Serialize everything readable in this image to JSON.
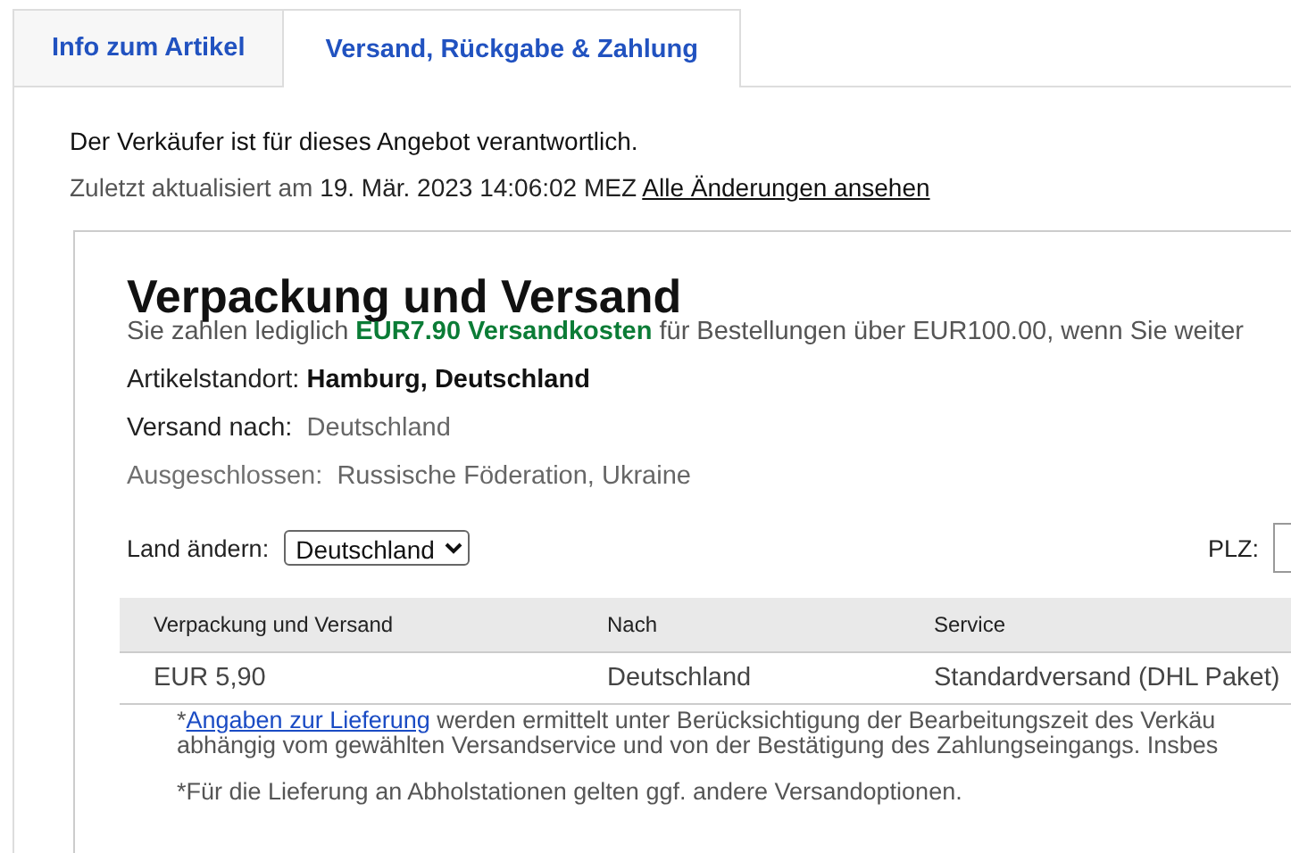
{
  "tabs": [
    {
      "label": "Info zum Artikel",
      "selected": false
    },
    {
      "label": "Versand, Rückgabe & Zahlung",
      "selected": true
    }
  ],
  "seller_note": "Der Verkäufer ist für dieses Angebot verantwortlich.",
  "last_updated": {
    "label": "Zuletzt aktualisiert am",
    "date": "19. Mär. 2023 14:06:02 MEZ",
    "link": "Alle Änderungen ansehen"
  },
  "shipping": {
    "title": "Verpackung und Versand",
    "promo": {
      "before": "Sie zahlen lediglich",
      "highlight": "EUR7.90 Versandkosten",
      "after": "für Bestellungen über EUR100.00, wenn Sie weiter"
    },
    "item_location": {
      "label": "Artikelstandort:",
      "value": "Hamburg, Deutschland"
    },
    "ships_to": {
      "label": "Versand nach:",
      "value": "Deutschland"
    },
    "excluded": {
      "label": "Ausgeschlossen:",
      "value": "Russische Föderation, Ukraine"
    },
    "country": {
      "label": "Land ändern:",
      "value": "Deutschland"
    },
    "postcode": {
      "label": "PLZ:"
    },
    "table": {
      "columns": [
        "Verpackung und Versand",
        "Nach",
        "Service"
      ],
      "rows": [
        [
          "EUR 5,90",
          "Deutschland",
          "Standardversand (DHL Paket)"
        ]
      ]
    },
    "delivery_note": {
      "before": "*",
      "link": "Angaben zur Lieferung",
      "after": " werden ermittelt unter Berücksichtigung der Bearbeitungszeit des Verkäu",
      "line_2": "abhängig vom gewählten Versandservice und von der Bestätigung des Zahlungseingangs. Insbes"
    },
    "pickup_note": "*Für die Lieferung an Abholstationen gelten ggf. andere Versandoptionen."
  }
}
